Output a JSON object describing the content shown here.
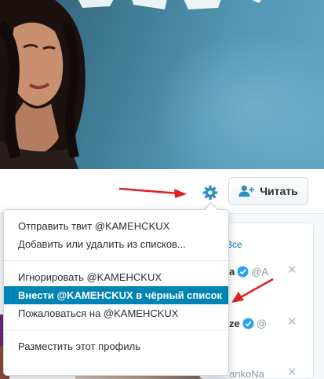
{
  "profile_nav": {
    "follow_label": "Читать"
  },
  "dropdown": {
    "items": [
      {
        "label": "Отправить твит @KAMEHCKUX"
      },
      {
        "label": "Добавить или удалить из списков..."
      },
      {
        "label": "Игнорировать @KAMEHCKUX"
      },
      {
        "label": "Внести @KAMEHCKUX в чёрный список",
        "selected": true
      },
      {
        "label": "Пожаловаться на @KAMEHCKUX"
      },
      {
        "label": "Разместить этот профиль"
      }
    ]
  },
  "who_to_follow": {
    "view_all_label": "Все",
    "rows": [
      {
        "name_fragment": "a",
        "handle_fragment": "@A"
      },
      {
        "name_fragment": "ze",
        "handle_fragment": "@"
      },
      {
        "name_fragment": "",
        "handle_fragment": "ankoNa"
      }
    ]
  },
  "colors": {
    "accent": "#0084b4",
    "verified": "#2aa3ef",
    "annotation_arrow": "#e02020"
  }
}
